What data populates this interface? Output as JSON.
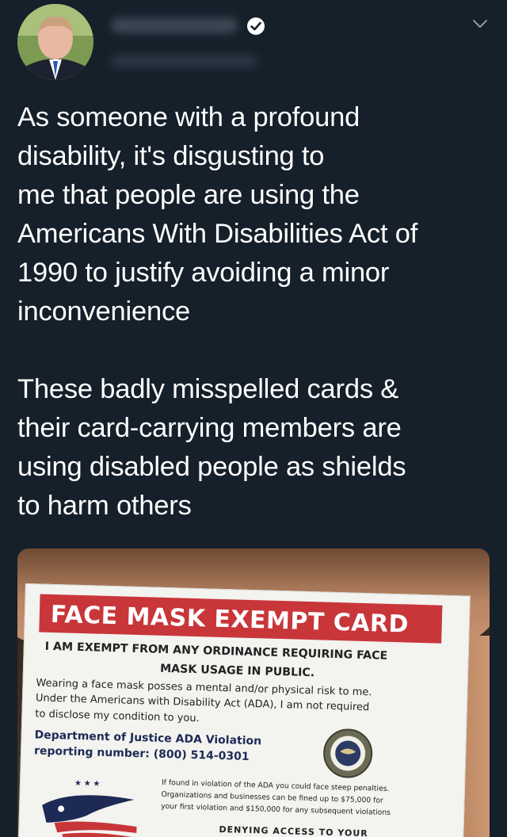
{
  "tweet": {
    "paragraph1": "As someone with a profound\ndisability, it's disgusting to\nme that people are using the\nAmericans With Disabilities Act of\n1990 to justify avoiding a minor\ninconvenience",
    "paragraph2": "These badly misspelled cards &\ntheir card-carrying members are\nusing disabled people as shields\nto harm others"
  },
  "icons": {
    "avatar": "profile-avatar",
    "verified": "verified-badge-icon",
    "menu": "chevron-down-icon"
  },
  "card": {
    "title": "FACE MASK EXEMPT CARD",
    "line1": "I AM EXEMPT FROM ANY ORDINANCE REQUIRING FACE",
    "line2": "MASK USAGE IN PUBLIC.",
    "line3": "Wearing a face mask posses a mental and/or physical risk to me.",
    "line4": "Under the Americans with Disability Act (ADA), I am not required",
    "line5": "to disclose my condition to you.",
    "line6": "Department of Justice ADA Violation",
    "line7": "reporting number: (800) 514-0301",
    "line8": "If found in violation of the ADA you could face steep penalties.",
    "line9": "Organizations and businesses can be fined up to $75,000 for",
    "line10": "your first violation and $150,000 for any subsequent violations",
    "line11": "DENYING ACCESS TO YOUR"
  },
  "colors": {
    "background": "#15202b",
    "text": "#ffffff",
    "card_red": "#c8363a"
  }
}
